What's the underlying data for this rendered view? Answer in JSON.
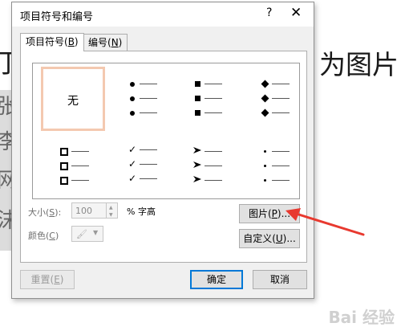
{
  "background": {
    "left_text": "打",
    "right_text": "为图片",
    "side_chars": [
      "张",
      "李",
      "网",
      "沫"
    ],
    "watermark": "Bai 经验"
  },
  "dialog": {
    "title": "项目符号和编号",
    "help_glyph": "?",
    "close_glyph": "✕",
    "tabs": [
      {
        "label": "项目符号(",
        "key": "B",
        "suffix": ")"
      },
      {
        "label": "编号(",
        "key": "N",
        "suffix": ")"
      }
    ],
    "bullets": {
      "none_label": "无",
      "styles": [
        "filled-round",
        "filled-square",
        "filled-diamond",
        "hollow-square",
        "checkmark",
        "arrowhead",
        "small-dot"
      ]
    },
    "size": {
      "label": "大小(",
      "key": "S",
      "suffix": "):",
      "value": "100",
      "unit": "% 字高"
    },
    "color": {
      "label": "颜色(",
      "key": "C",
      "suffix": ")"
    },
    "buttons": {
      "picture": {
        "label": "图片(",
        "key": "P",
        "suffix": ")..."
      },
      "customize": {
        "label": "自定义(",
        "key": "U",
        "suffix": ")..."
      },
      "reset": {
        "label": "重置(",
        "key": "E",
        "suffix": ")"
      },
      "ok": "确定",
      "cancel": "取消"
    }
  },
  "colors": {
    "accent": "#0078d7",
    "selection": "#f4c9b0",
    "annotation_arrow": "#e8392f"
  }
}
